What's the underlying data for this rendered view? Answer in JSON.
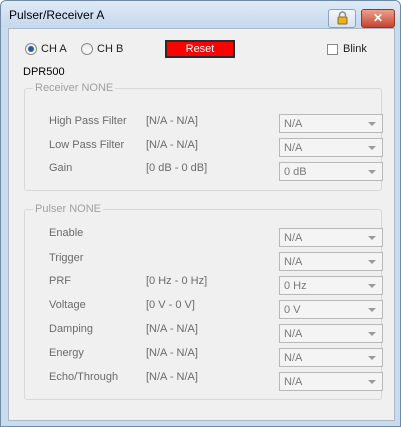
{
  "window": {
    "title": "Pulser/Receiver A",
    "close_glyph": "✕"
  },
  "channel": {
    "a_label": "CH A",
    "b_label": "CH B",
    "selected": "CH A"
  },
  "reset_label": "Reset",
  "blink_label": "Blink",
  "device": "DPR500",
  "receiver": {
    "title": "Receiver NONE",
    "rows": [
      {
        "label": "High Pass Filter",
        "range": "[N/A - N/A]",
        "value": "N/A"
      },
      {
        "label": "Low Pass Filter",
        "range": "[N/A - N/A]",
        "value": "N/A"
      },
      {
        "label": "Gain",
        "range": "[0 dB - 0 dB]",
        "value": "0 dB"
      }
    ]
  },
  "pulser": {
    "title": "Pulser NONE",
    "rows": [
      {
        "label": "Enable",
        "range": "",
        "value": "N/A"
      },
      {
        "label": "Trigger",
        "range": "",
        "value": "N/A"
      },
      {
        "label": "PRF",
        "range": "[0 Hz - 0 Hz]",
        "value": "0 Hz"
      },
      {
        "label": "Voltage",
        "range": "[0 V - 0 V]",
        "value": "0 V"
      },
      {
        "label": "Damping",
        "range": "[N/A - N/A]",
        "value": "N/A"
      },
      {
        "label": "Energy",
        "range": "[N/A - N/A]",
        "value": "N/A"
      },
      {
        "label": "Echo/Through",
        "range": "[N/A - N/A]",
        "value": "N/A"
      }
    ]
  },
  "colors": {
    "reset_bg": "#ff0000",
    "titlebar": "#c6d8ec",
    "close_bg": "#c7442b"
  }
}
